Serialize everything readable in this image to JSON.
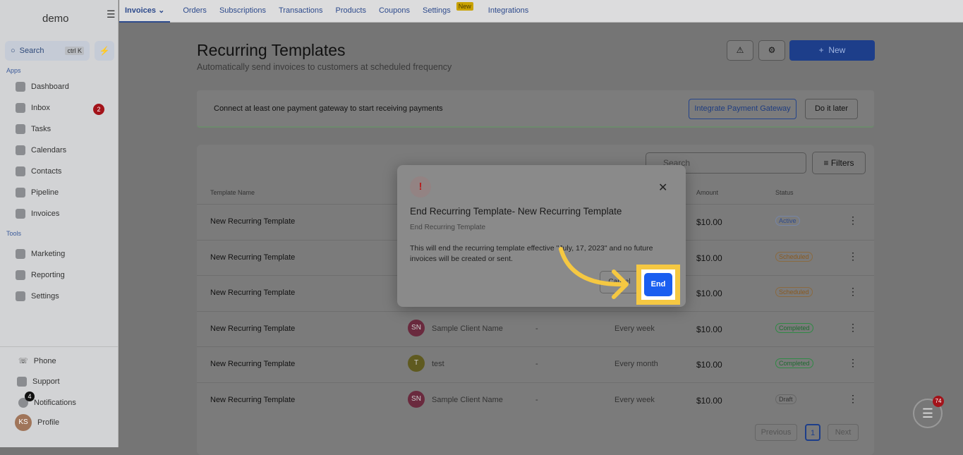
{
  "sidebar": {
    "logo": "demo",
    "search_label": "Search",
    "search_shortcut": "ctrl K",
    "apps_label": "Apps",
    "tools_label": "Tools",
    "apps": [
      {
        "label": "Dashboard"
      },
      {
        "label": "Inbox",
        "badge": "2"
      },
      {
        "label": "Tasks"
      },
      {
        "label": "Calendars"
      },
      {
        "label": "Contacts"
      },
      {
        "label": "Pipeline"
      },
      {
        "label": "Invoices"
      }
    ],
    "tools": [
      {
        "label": "Marketing"
      },
      {
        "label": "Reporting"
      },
      {
        "label": "Settings"
      }
    ],
    "bottom": {
      "phone": "Phone",
      "support": "Support",
      "notifications": "Notifications",
      "notifications_badge": "4",
      "profile": "Profile",
      "profile_initials": "KS"
    }
  },
  "topnav": {
    "tabs": [
      "Invoices",
      "Orders",
      "Subscriptions",
      "Transactions",
      "Products",
      "Coupons",
      "Settings",
      "Integrations"
    ],
    "new_tag": "New"
  },
  "page": {
    "title": "Recurring Templates",
    "subtitle": "Automatically send invoices to customers at scheduled frequency",
    "new_button": "New"
  },
  "banner": {
    "text": "Connect at least one payment gateway to start receiving payments",
    "integrate": "Integrate Payment Gateway",
    "later": "Do it later"
  },
  "table": {
    "search_placeholder": "Search",
    "filters": "Filters",
    "headers": {
      "name": "Template Name",
      "amount": "Amount",
      "status": "Status"
    },
    "rows": [
      {
        "name": "New Recurring Template",
        "amount": "$10.00",
        "status": "Active"
      },
      {
        "name": "New Recurring Template",
        "amount": "$10.00",
        "status": "Scheduled"
      },
      {
        "name": "New Recurring Template",
        "amount": "$10.00",
        "status": "Scheduled"
      },
      {
        "name": "New Recurring Template",
        "initials": "SN",
        "client": "Sample Client Name",
        "dash": "-",
        "frequency": "Every week",
        "amount": "$10.00",
        "status": "Completed"
      },
      {
        "name": "New Recurring Template",
        "initials": "T",
        "client": "test",
        "dash": "-",
        "frequency": "Every month",
        "amount": "$10.00",
        "status": "Completed"
      },
      {
        "name": "New Recurring Template",
        "initials": "SN",
        "client": "Sample Client Name",
        "dash": "-",
        "frequency": "Every week",
        "amount": "$10.00",
        "status": "Draft"
      }
    ],
    "pagination": {
      "previous": "Previous",
      "page": "1",
      "next": "Next"
    }
  },
  "modal": {
    "title": "End Recurring Template- New Recurring Template",
    "subtitle": "End Recurring Template",
    "body": "This will end the recurring template effective \"July, 17, 2023\" and no future invoices will be created or sent.",
    "cancel": "Cancel",
    "end": "End"
  },
  "chat_badge": "74",
  "colors": {
    "primary": "#1a5ef0",
    "highlight": "#f5c842",
    "danger": "#b52020"
  }
}
